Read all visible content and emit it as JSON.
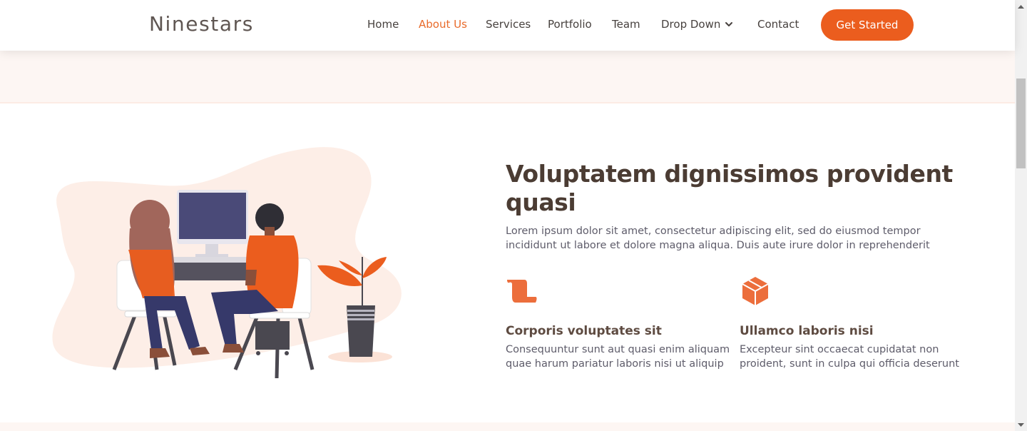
{
  "header": {
    "logo": "Ninestars",
    "nav": [
      {
        "label": "Home"
      },
      {
        "label": "About Us"
      },
      {
        "label": "Services"
      },
      {
        "label": "Portfolio"
      },
      {
        "label": "Team"
      },
      {
        "label": "Drop Down"
      },
      {
        "label": "Contact"
      }
    ],
    "cta": "Get Started"
  },
  "about": {
    "heading": "Voluptatem dignissimos provident quasi",
    "lead": "Lorem ipsum dolor sit amet, consectetur adipiscing elit, sed do eiusmod tempor incididunt ut labore et dolore magna aliqua. Duis aute irure dolor in reprehenderit",
    "features": [
      {
        "icon": "scroll-icon",
        "title": "Corporis voluptates sit",
        "text": "Consequuntur sunt aut quasi enim aliquam quae harum pariatur laboris nisi ut aliquip"
      },
      {
        "icon": "cube-icon",
        "title": "Ullamco laboris nisi",
        "text": "Excepteur sint occaecat cupidatat non proident, sunt in culpa qui officia deserunt"
      }
    ]
  },
  "colors": {
    "accent": "#eb5d1e",
    "active_nav": "#e96b2b",
    "heading": "#4b3c33",
    "band": "#fdf6f3"
  }
}
